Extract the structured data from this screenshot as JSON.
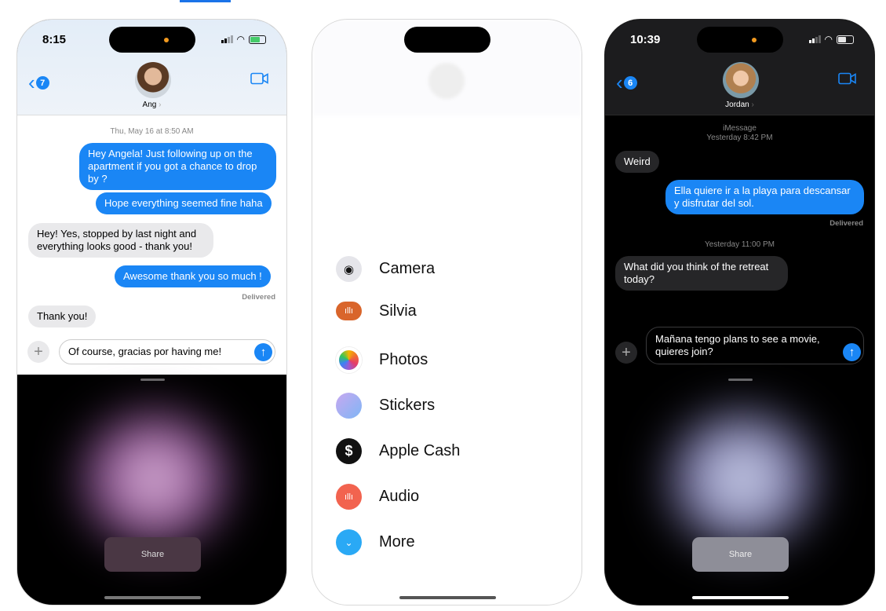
{
  "phones": [
    {
      "theme": "light",
      "status": {
        "time": "8:15"
      },
      "header": {
        "back_count": "7",
        "contact": "Ang",
        "chevron": "›"
      },
      "timestamp": "Thu, May 16 at 8:50 AM",
      "messages": [
        {
          "dir": "out",
          "text": "Hey Angela! Just following up on the apartment if you got a chance to drop by ?"
        },
        {
          "dir": "out",
          "text": "Hope everything seemed fine haha"
        },
        {
          "dir": "in",
          "text": "Hey! Yes, stopped by last night and everything looks good - thank you!"
        },
        {
          "dir": "out",
          "text": "Awesome thank you so much !"
        },
        {
          "dir": "in",
          "text": "Thank you!"
        }
      ],
      "delivered": "Delivered",
      "input_value": "Of course, gracias por having me!",
      "share_label": "Share"
    },
    {
      "menu": [
        {
          "label": "Camera",
          "icon": "camera-icon",
          "color": "#e5e5ea"
        },
        {
          "label": "Silvia",
          "icon": "waveform-icon",
          "color": "#d9652b"
        },
        {
          "label": "Photos",
          "icon": "photos-icon",
          "color": "#ffffff"
        },
        {
          "label": "Stickers",
          "icon": "stickers-icon",
          "color": "#a9a6f5"
        },
        {
          "label": "Apple Cash",
          "icon": "dollar-icon",
          "color": "#111111"
        },
        {
          "label": "Audio",
          "icon": "waveform-icon",
          "color": "#f2634f"
        },
        {
          "label": "More",
          "icon": "chevron-down-icon",
          "color": "#2aa9f5"
        }
      ]
    },
    {
      "theme": "dark",
      "status": {
        "time": "10:39"
      },
      "header": {
        "back_count": "6",
        "contact": "Jordan",
        "chevron": "›"
      },
      "timestamp1": "iMessage",
      "timestamp2": "Yesterday 8:42 PM",
      "timestamp3": "Yesterday 11:00 PM",
      "messages": [
        {
          "dir": "in",
          "text": "Weird"
        },
        {
          "dir": "out",
          "text": "Ella quiere ir a la playa para descansar y disfrutar del sol."
        },
        {
          "dir": "in",
          "text": "What did you think of the retreat today?"
        }
      ],
      "delivered": "Delivered",
      "input_value": "Mañana tengo plans to see a movie, quieres join?",
      "share_label": "Share"
    }
  ],
  "colors": {
    "imessage_blue": "#1a86f5",
    "accent_tab": "#1a73e8"
  }
}
